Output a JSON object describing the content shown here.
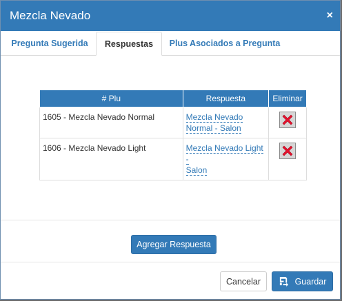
{
  "modal": {
    "title": "Mezcla Nevado",
    "close_glyph": "×"
  },
  "tabs": [
    {
      "label": "Pregunta Sugerida",
      "active": false
    },
    {
      "label": "Respuestas",
      "active": true
    },
    {
      "label": "Plus Asociados a Pregunta",
      "active": false
    }
  ],
  "table": {
    "headers": [
      "# Plu",
      "Respuesta",
      "Eliminar"
    ],
    "rows": [
      {
        "plu": "1605 - Mezcla Nevado Normal",
        "respuesta_line1": "Mezcla Nevado",
        "respuesta_line2": "Normal - Salon"
      },
      {
        "plu": "1606 - Mezcla Nevado Light",
        "respuesta_line1": "Mezcla Nevado Light -",
        "respuesta_line2": "Salon"
      }
    ]
  },
  "buttons": {
    "agregar": "Agregar Respuesta",
    "cancelar": "Cancelar",
    "guardar": "Guardar"
  },
  "icons": {
    "delete": "red-x-icon",
    "save": "save-icon"
  },
  "colors": {
    "primary": "#337ab7",
    "delete_red": "#e8112d"
  }
}
